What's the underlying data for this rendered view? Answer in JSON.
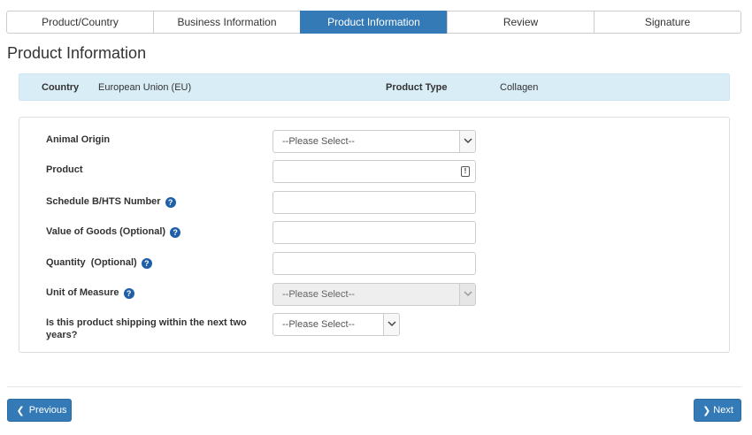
{
  "steps": [
    {
      "label": "Product/Country"
    },
    {
      "label": "Business Information"
    },
    {
      "label": "Product Information",
      "active": true
    },
    {
      "label": "Review"
    },
    {
      "label": "Signature"
    }
  ],
  "page_title": "Product Information",
  "summary": {
    "country_label": "Country",
    "country_value": "European Union (EU)",
    "product_type_label": "Product Type",
    "product_type_value": "Collagen"
  },
  "form": {
    "animal_origin": {
      "label": "Animal Origin",
      "value": "--Please Select--"
    },
    "product": {
      "label": "Product",
      "value": ""
    },
    "schedule_b": {
      "label": "Schedule B/HTS Number",
      "value": ""
    },
    "value_of_goods": {
      "label": "Value of Goods (Optional)",
      "value": ""
    },
    "quantity": {
      "label": "Quantity  (Optional)",
      "value": ""
    },
    "unit_of_measure": {
      "label": "Unit of Measure",
      "value": "--Please Select--"
    },
    "shipping_within": {
      "label_line1": "Is this product shipping within the next two",
      "label_line2": "years?",
      "value": "--Please Select--"
    }
  },
  "buttons": {
    "previous": "Previous",
    "next": "Next"
  },
  "colors": {
    "primary": "#337ab7",
    "summary_bg": "#d9edf7",
    "help_icon": "#1f5fa8"
  },
  "icons": {
    "help": "?",
    "alert": "!"
  }
}
